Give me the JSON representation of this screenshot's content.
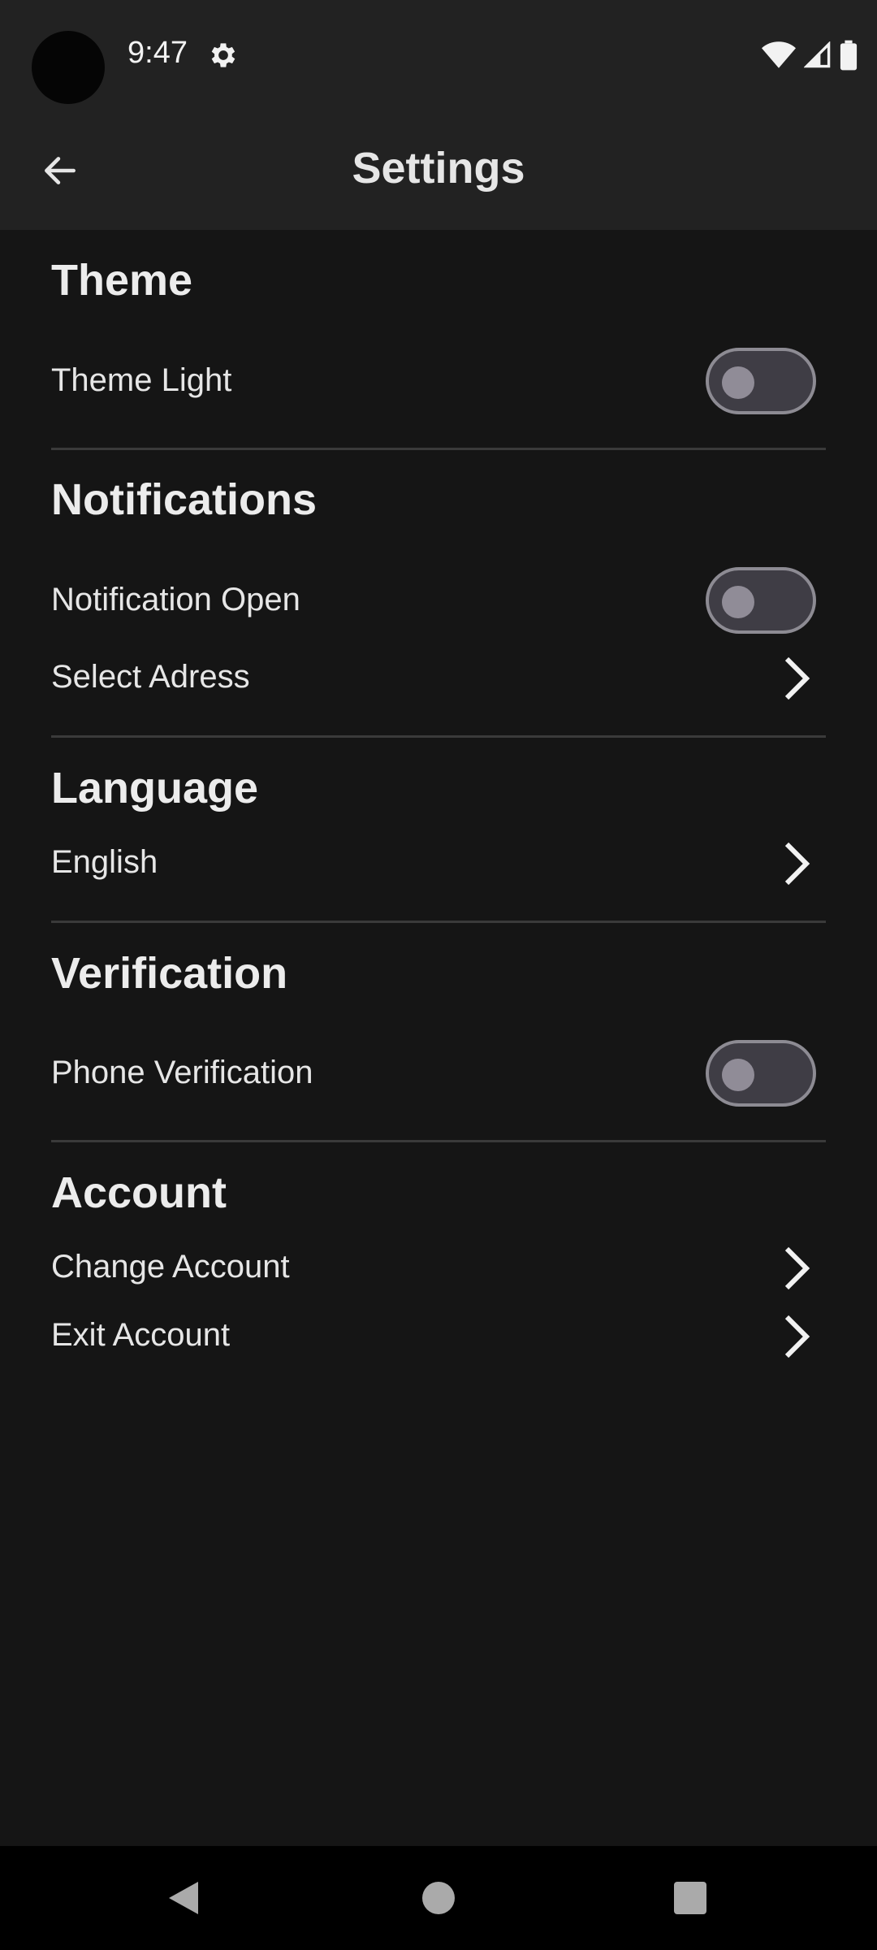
{
  "status_bar": {
    "time": "9:47",
    "icons": [
      "camera-cutout",
      "gear-icon",
      "wifi-icon",
      "signal-icon",
      "battery-icon"
    ]
  },
  "toolbar": {
    "title": "Settings",
    "back_icon": "arrow-left-icon"
  },
  "sections": {
    "theme": {
      "title": "Theme",
      "theme_light": {
        "label": "Theme Light",
        "checked": false
      }
    },
    "notifications": {
      "title": "Notifications",
      "notification_open": {
        "label": "Notification Open",
        "checked": false
      },
      "select_address": {
        "label": "Select Adress"
      }
    },
    "language": {
      "title": "Language",
      "current": {
        "label": "English"
      }
    },
    "verification": {
      "title": "Verification",
      "phone_verification": {
        "label": "Phone Verification",
        "checked": false
      }
    },
    "account": {
      "title": "Account",
      "change_account": {
        "label": "Change Account"
      },
      "exit_account": {
        "label": "Exit Account"
      }
    }
  },
  "nav_bar": {
    "buttons": [
      "back-triangle-icon",
      "home-circle-icon",
      "recents-square-icon"
    ]
  },
  "colors": {
    "background": "#151515",
    "bar": "#222222",
    "text": "#e6e6e6",
    "divider": "#3a3a3a",
    "toggle_track": "#3f3d45",
    "toggle_border": "#8d8b93"
  }
}
